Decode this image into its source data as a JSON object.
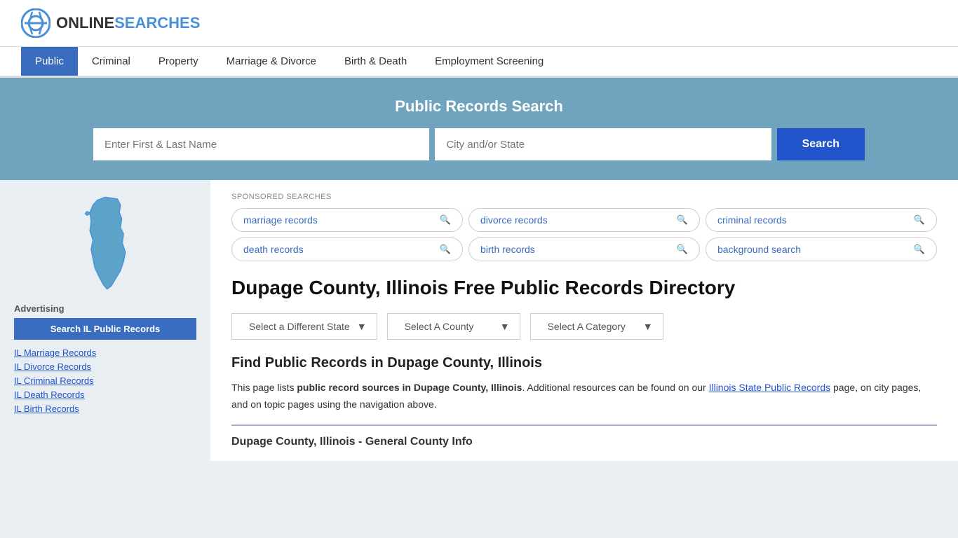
{
  "header": {
    "logo_text_online": "ONLINE",
    "logo_text_searches": "SEARCHES"
  },
  "nav": {
    "items": [
      {
        "label": "Public",
        "active": true
      },
      {
        "label": "Criminal",
        "active": false
      },
      {
        "label": "Property",
        "active": false
      },
      {
        "label": "Marriage & Divorce",
        "active": false
      },
      {
        "label": "Birth & Death",
        "active": false
      },
      {
        "label": "Employment Screening",
        "active": false
      }
    ]
  },
  "search_banner": {
    "title": "Public Records Search",
    "name_placeholder": "Enter First & Last Name",
    "location_placeholder": "City and/or State",
    "button_label": "Search"
  },
  "sponsored": {
    "label": "SPONSORED SEARCHES",
    "tags": [
      {
        "text": "marriage records"
      },
      {
        "text": "divorce records"
      },
      {
        "text": "criminal records"
      },
      {
        "text": "death records"
      },
      {
        "text": "birth records"
      },
      {
        "text": "background search"
      }
    ]
  },
  "page": {
    "title": "Dupage County, Illinois Free Public Records Directory",
    "dropdowns": {
      "state": "Select a Different State",
      "county": "Select A County",
      "category": "Select A Category"
    },
    "find_heading": "Find Public Records in Dupage County, Illinois",
    "find_text_1": "This page lists ",
    "find_text_bold": "public record sources in Dupage County, Illinois",
    "find_text_2": ". Additional resources can be found on our ",
    "find_link": "Illinois State Public Records",
    "find_text_3": " page, on city pages, and on topic pages using the navigation above.",
    "general_info_heading": "Dupage County, Illinois - General County Info"
  },
  "sidebar": {
    "advertising_label": "Advertising",
    "ad_button": "Search IL Public Records",
    "links": [
      {
        "text": "IL Marriage Records"
      },
      {
        "text": "IL Divorce Records"
      },
      {
        "text": "IL Criminal Records"
      },
      {
        "text": "IL Death Records"
      },
      {
        "text": "IL Birth Records"
      }
    ]
  }
}
